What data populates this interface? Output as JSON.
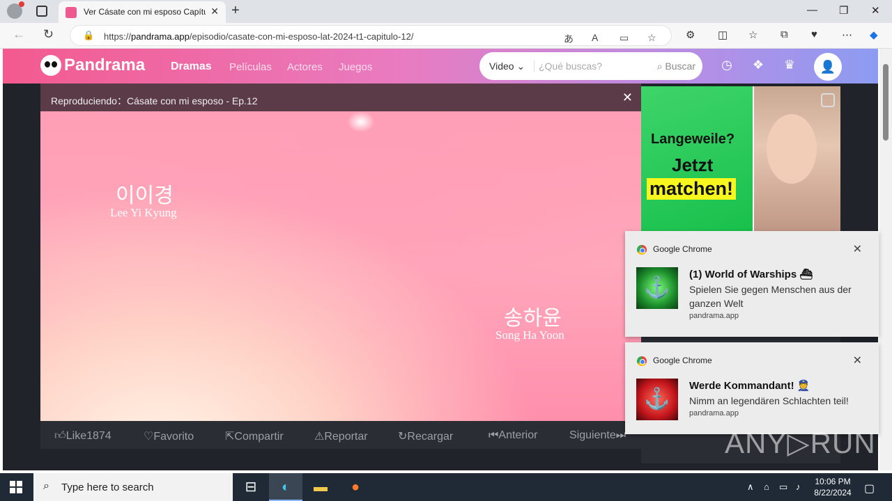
{
  "browser": {
    "tab_title": "Ver Cásate con mi esposo Capítul",
    "url_prefix": "https://",
    "url_domain": "pandrama.app",
    "url_path": "/episodio/casate-con-mi-esposo-lat-2024-t1-capitulo-12/"
  },
  "site": {
    "logo": "Pandrama",
    "nav": [
      "Dramas",
      "Películas",
      "Actores",
      "Juegos"
    ],
    "search_select": "Video",
    "search_placeholder": "¿Qué buscas?",
    "search_button": "Buscar"
  },
  "player": {
    "now_playing": "Reproduciendo：Cásate con mi esposo - Ep.12",
    "credit1_kr": "이이경",
    "credit1_en": "Lee Yi Kyung",
    "credit2_kr": "송하윤",
    "credit2_en": "Song Ha Yoon",
    "controls": [
      "Like1874",
      "Favorito",
      "Compartir",
      "Reportar",
      "Recargar",
      "Anterior",
      "Siguiente"
    ]
  },
  "ad": {
    "line1": "Langeweile?",
    "line2": "Jetzt",
    "line3": "matchen!"
  },
  "notifications": [
    {
      "source": "Google Chrome",
      "title": "(1) World of Warships ⛴",
      "body": "Spielen Sie gegen Menschen aus der ganzen Welt",
      "domain": "pandrama.app"
    },
    {
      "source": "Google Chrome",
      "title": "Werde Kommandant! 👮",
      "body": "Nimm an legendären Schlachten teil!",
      "domain": "pandrama.app"
    }
  ],
  "watermark": "ANY▷RUN",
  "taskbar": {
    "search_placeholder": "Type here to search",
    "time": "10:06 PM",
    "date": "8/22/2024"
  }
}
